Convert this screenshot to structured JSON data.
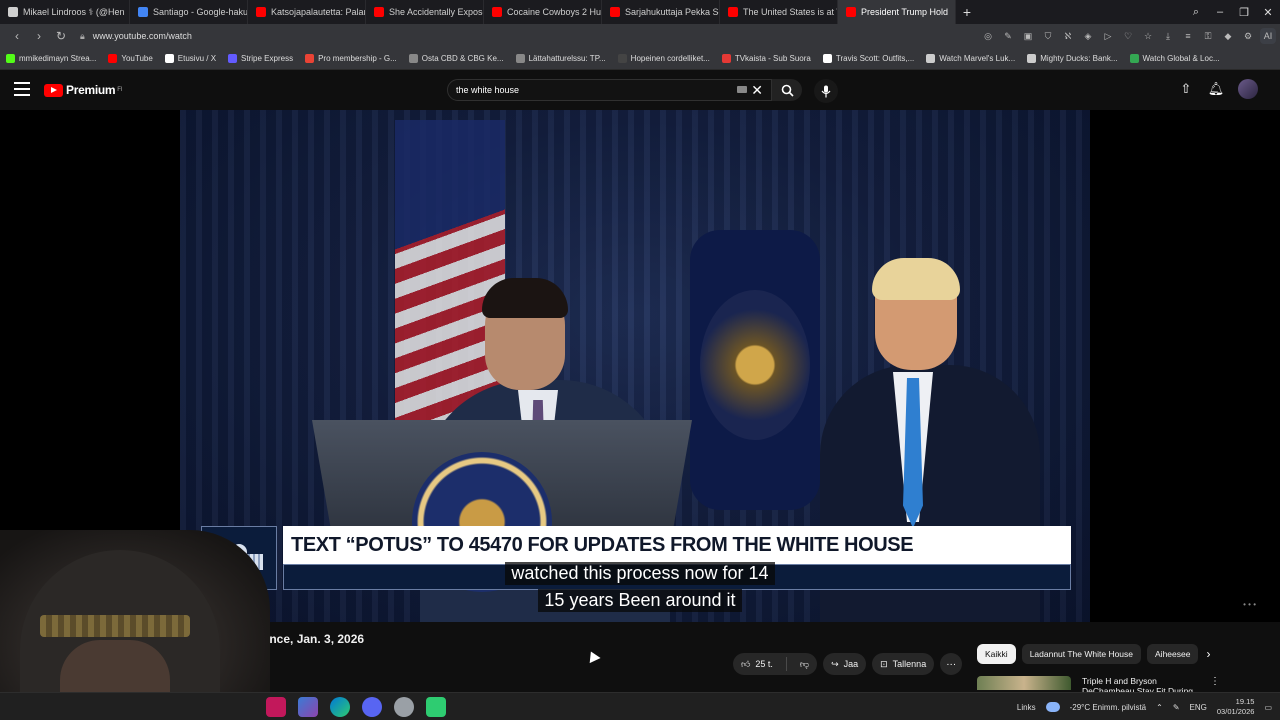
{
  "browser": {
    "tabs": [
      {
        "title": "Mikael Lindroos ⚕ (@Hen",
        "color": "#cfcfcf",
        "active": false
      },
      {
        "title": "Santiago - Google-haku",
        "color": "#4285f4",
        "active": false
      },
      {
        "title": "Katsojapalautetta: Paland",
        "color": "#ff0000",
        "active": false
      },
      {
        "title": "She Accidentally Exposed",
        "color": "#ff0000",
        "active": false
      },
      {
        "title": "Cocaine Cowboys 2 Hustl",
        "color": "#ff0000",
        "active": false
      },
      {
        "title": "Sarjahukuttaja Pekka Sepp",
        "color": "#ff0000",
        "active": false
      },
      {
        "title": "The United States is at Wa",
        "color": "#ff0000",
        "active": false
      },
      {
        "title": "President Trump Hold",
        "color": "#ff0000",
        "active": true
      }
    ],
    "new_tab": "+",
    "url": "www.youtube.com/watch",
    "ai_label": "AI",
    "bookmarks": [
      {
        "label": "mmikedimayn Strea...",
        "color": "#53fc18"
      },
      {
        "label": "YouTube",
        "color": "#ff0000"
      },
      {
        "label": "Etusivu / X",
        "color": "#ffffff"
      },
      {
        "label": "Stripe Express",
        "color": "#635bff"
      },
      {
        "label": "Pro membership - G...",
        "color": "#ea4335"
      },
      {
        "label": "Osta CBD & CBG Ke...",
        "color": "#888888"
      },
      {
        "label": "Lättahatturelssu: TP...",
        "color": "#888888"
      },
      {
        "label": "Hopeinen cordelliket...",
        "color": "#444444"
      },
      {
        "label": "TVkaista - Sub Suora",
        "color": "#e53935"
      },
      {
        "label": "Travis Scott: Outfits,...",
        "color": "#ffffff"
      },
      {
        "label": "Watch Marvel's Luk...",
        "color": "#cccccc"
      },
      {
        "label": "Mighty Ducks: Bank...",
        "color": "#cccccc"
      },
      {
        "label": "Watch Global & Loc...",
        "color": "#34a853"
      }
    ]
  },
  "youtube": {
    "logo_text": "Premium",
    "logo_sup": "FI",
    "search_value": "the white house",
    "icons": {
      "menu": "hamburger-icon",
      "search": "search-icon",
      "mic": "mic-icon",
      "upload": "upload-icon",
      "notifications": "bell-icon"
    }
  },
  "video": {
    "banner_text": "TEXT “POTUS” TO 45470 FOR UPDATES FROM THE WHITE HOUSE",
    "caption_line1": "watched this process now for 14",
    "caption_line2": "15 years Been around it",
    "title_partial": "rence, Jan. 3, 2026"
  },
  "actions": {
    "like_count": "25 t.",
    "share_label": "Jaa",
    "save_label": "Tallenna",
    "more": "···"
  },
  "chips": [
    {
      "label": "Kaikki",
      "active": true
    },
    {
      "label": "Ladannut The White House",
      "active": false
    },
    {
      "label": "Aiheesee",
      "active": false
    }
  ],
  "recommendation": {
    "title_line1": "Triple H and Bryson",
    "title_line2": "DeChambeau Stay Fit During"
  },
  "taskbar": {
    "links_label": "Links",
    "weather": "-29°C  Enimm. pilvistä",
    "lang": "ENG",
    "time": "19.15",
    "date": "03/01/2026"
  }
}
